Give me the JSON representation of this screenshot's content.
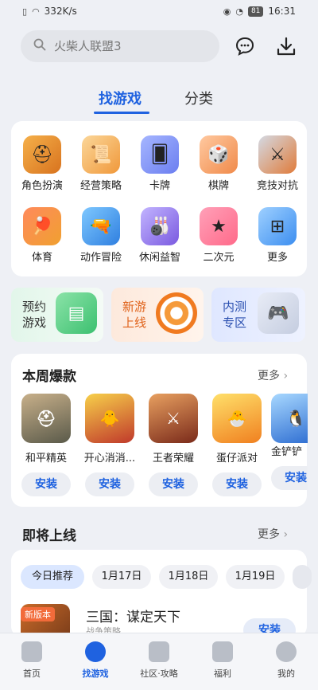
{
  "status_bar": {
    "speed": "332K/s",
    "battery": "81",
    "time": "16:31"
  },
  "search": {
    "placeholder": "火柴人联盟3"
  },
  "tabs": [
    {
      "label": "找游戏"
    },
    {
      "label": "分类"
    }
  ],
  "categories": [
    {
      "label": "角色扮演",
      "icon": "helmet-icon"
    },
    {
      "label": "经营策略",
      "icon": "scroll-icon"
    },
    {
      "label": "卡牌",
      "icon": "cards-icon"
    },
    {
      "label": "棋牌",
      "icon": "dice-icon"
    },
    {
      "label": "竞技对抗",
      "icon": "axe-sword-icon"
    },
    {
      "label": "体育",
      "icon": "ping-pong-icon"
    },
    {
      "label": "动作冒险",
      "icon": "blaster-icon"
    },
    {
      "label": "休闲益智",
      "icon": "bowling-icon"
    },
    {
      "label": "二次元",
      "icon": "star-wand-icon"
    },
    {
      "label": "更多",
      "icon": "grid-buttons-icon"
    }
  ],
  "promos": [
    {
      "line1": "预约",
      "line2": "游戏",
      "icon": "calendar-icon"
    },
    {
      "line1": "新游",
      "line2": "上线",
      "icon": "target-icon"
    },
    {
      "line1": "内测",
      "line2": "专区",
      "icon": "gamepad-icon"
    }
  ],
  "hot": {
    "title": "本周爆款",
    "more": "更多",
    "install_label": "安装",
    "games": [
      {
        "name": "和平精英",
        "color": "#7a7a6a"
      },
      {
        "name": "开心消消...",
        "color": "#c0392b"
      },
      {
        "name": "王者荣耀",
        "color": "#b8412f"
      },
      {
        "name": "蛋仔派对",
        "color": "#f0a020"
      },
      {
        "name": "金铲铲",
        "color": "#3a78d0"
      }
    ]
  },
  "upcoming": {
    "title": "即将上线",
    "more": "更多",
    "chips": [
      "今日推荐",
      "1月17日",
      "1月18日",
      "1月19日"
    ],
    "item": {
      "badge": "新版本",
      "name": "三国：谋定天下",
      "sub": "战争策略",
      "install_label": "安装"
    }
  },
  "bottom_nav": [
    {
      "label": "首页"
    },
    {
      "label": "找游戏"
    },
    {
      "label": "社区·攻略"
    },
    {
      "label": "福利"
    },
    {
      "label": "我的"
    }
  ]
}
